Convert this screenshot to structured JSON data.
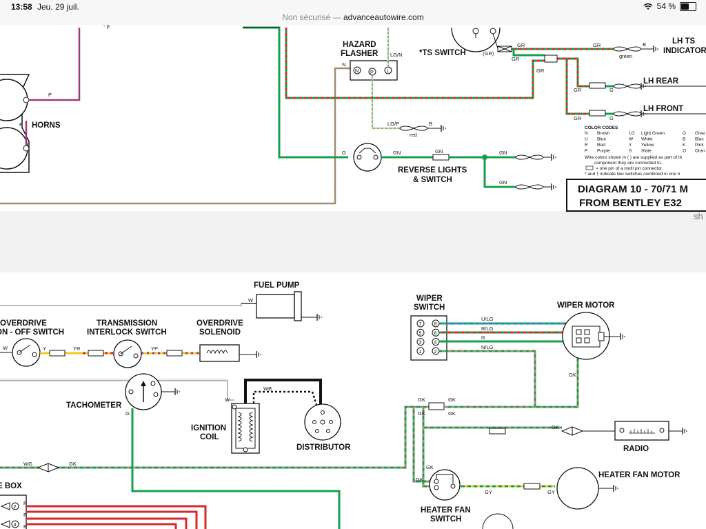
{
  "status_bar": {
    "time": "13:58",
    "date": "Jeu. 29 juil.",
    "battery": "54 %",
    "battery_level": 0.54
  },
  "url_bar": {
    "security": "Non sécurisé",
    "separator": "—",
    "domain": "advanceautowire.com"
  },
  "colors": {
    "green": "#12a14a",
    "red": "#d42a2a",
    "brown": "#a08d72",
    "purple": "#9a3b80",
    "blue": "#2f8fd0",
    "yellow": "#f0c91c",
    "black": "#111111"
  },
  "top_panel": {
    "components": {
      "horns": "HORNS",
      "hazard_flasher_1": "HAZARD",
      "hazard_flasher_2": "FLASHER",
      "ts_switch": "*TS SWITCH",
      "lh_ts_indicator_1": "LH TS",
      "lh_ts_indicator_2": "INDICATOR",
      "lh_rear": "LH REAR",
      "lh_front": "LH FRONT",
      "reverse_lights_1": "REVERSE LIGHTS",
      "reverse_lights_2": "& SWITCH"
    },
    "terminals": {
      "n": "N",
      "p": "P",
      "l": "L"
    },
    "wire_labels": {
      "p": "P",
      "n": "N",
      "lgn": "LG/N",
      "lgp": "LG/P",
      "red": "red",
      "b": "B",
      "gn": "GN",
      "g": "G",
      "gr": "GR",
      "gr_paren": "(GR)",
      "green": "green"
    },
    "color_codes": {
      "title": "COLOR CODES",
      "entries": [
        [
          "N",
          "Brown",
          "LG",
          "Light Green",
          "G",
          "Gree"
        ],
        [
          "U",
          "Blue",
          "W",
          "White",
          "B",
          "Blac"
        ],
        [
          "R",
          "Red",
          "Y",
          "Yellow",
          "K",
          "Pink"
        ],
        [
          "P",
          "Purple",
          "S",
          "Slate",
          "O",
          "Oran"
        ]
      ],
      "note1": "Wire colors shown in ( ) are supplied as part of th",
      "note2": "component they are connected to.",
      "note3": "= one pin of a multi pin connector.",
      "note4": "* and † indicate two switches combined in one h"
    },
    "title_box": {
      "line1": "DIAGRAM 10 - 70/71 M",
      "line2": "FROM BENTLEY E32"
    },
    "footer_fragment": "sh"
  },
  "bottom_panel": {
    "components": {
      "fuel_pump": "FUEL PUMP",
      "overdrive_switch_1": "OVERDRIVE",
      "overdrive_switch_2": "ON - OFF SWITCH",
      "transmission_1": "TRANSMISSION",
      "transmission_2": "INTERLOCK SWITCH",
      "overdrive_solenoid_1": "OVERDRIVE",
      "overdrive_solenoid_2": "SOLENOID",
      "wiper_switch_1": "WIPER",
      "wiper_switch_2": "SWITCH",
      "wiper_motor": "WIPER MOTOR",
      "tachometer": "TACHOMETER",
      "ignition_coil_1": "IGNITION",
      "ignition_coil_2": "COIL",
      "distributor": "DISTRIBUTOR",
      "radio": "RADIO",
      "heater_fan_motor": "HEATER FAN MOTOR",
      "heater_fan_switch_1": "HEATER FAN",
      "heater_fan_switch_2": "SWITCH",
      "fuse_box": "E BOX"
    },
    "switch_pins": [
      "7",
      "8",
      "5",
      "6",
      "3",
      "4",
      "1",
      "2"
    ],
    "fuse_numbers": [
      "2",
      "4"
    ],
    "wire_labels": {
      "w": "W",
      "y": "Y",
      "yr": "YR",
      "yp": "YP",
      "ulg": "U/LG",
      "rlg": "R/LG",
      "g": "G",
      "nlg": "N/LG",
      "gk": "GK",
      "wb": "WB",
      "wg": "WG",
      "gy": "GY",
      "r": "R"
    }
  }
}
